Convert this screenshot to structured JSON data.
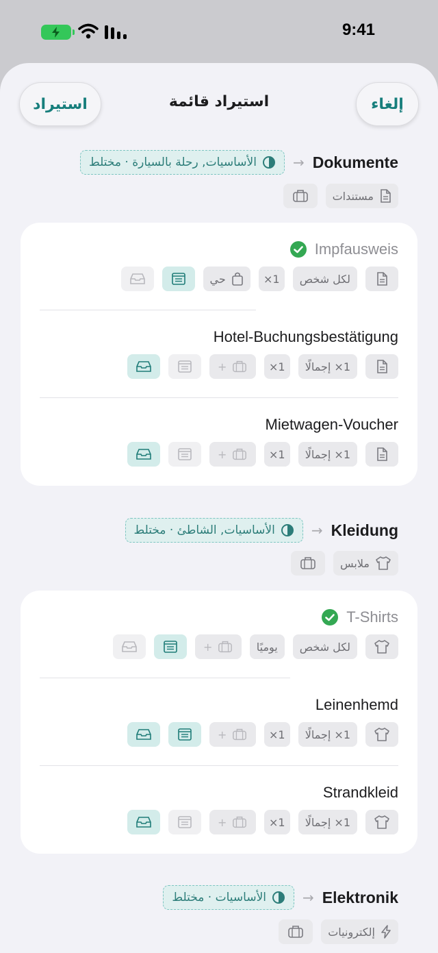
{
  "status": {
    "time": "9:41"
  },
  "nav": {
    "title": "استيراد قائمة",
    "import_label": "استيراد",
    "cancel_label": "إلغاء"
  },
  "categories": [
    {
      "name": "Dokumente",
      "tag": "الأساسيات, رحلة بالسيارة · مختلط",
      "type_label": "مستندات",
      "items": [
        {
          "name": "Impfausweis",
          "done": true,
          "qty": "لكل شخص",
          "mult": "1×",
          "extra": "حي"
        },
        {
          "name": "Hotel-Buchungsbestätigung",
          "done": false,
          "qty": "1× إجمالًا",
          "mult": "1×"
        },
        {
          "name": "Mietwagen-Voucher",
          "done": false,
          "qty": "1× إجمالًا",
          "mult": "1×"
        }
      ]
    },
    {
      "name": "Kleidung",
      "tag": "الأساسيات, الشاطئ · مختلط",
      "type_label": "ملابس",
      "items": [
        {
          "name": "T-Shirts",
          "done": true,
          "qty": "لكل شخص",
          "mult": "يوميًا"
        },
        {
          "name": "Leinenhemd",
          "done": false,
          "qty": "1× إجمالًا",
          "mult": "1×"
        },
        {
          "name": "Strandkleid",
          "done": false,
          "qty": "1× إجمالًا",
          "mult": "1×"
        }
      ]
    },
    {
      "name": "Elektronik",
      "tag": "الأساسيات · مختلط",
      "type_label": "إلكترونيات"
    }
  ],
  "colors": {
    "accent": "#177e7c",
    "check": "#34a853",
    "tag_bg": "#dff0ef"
  }
}
